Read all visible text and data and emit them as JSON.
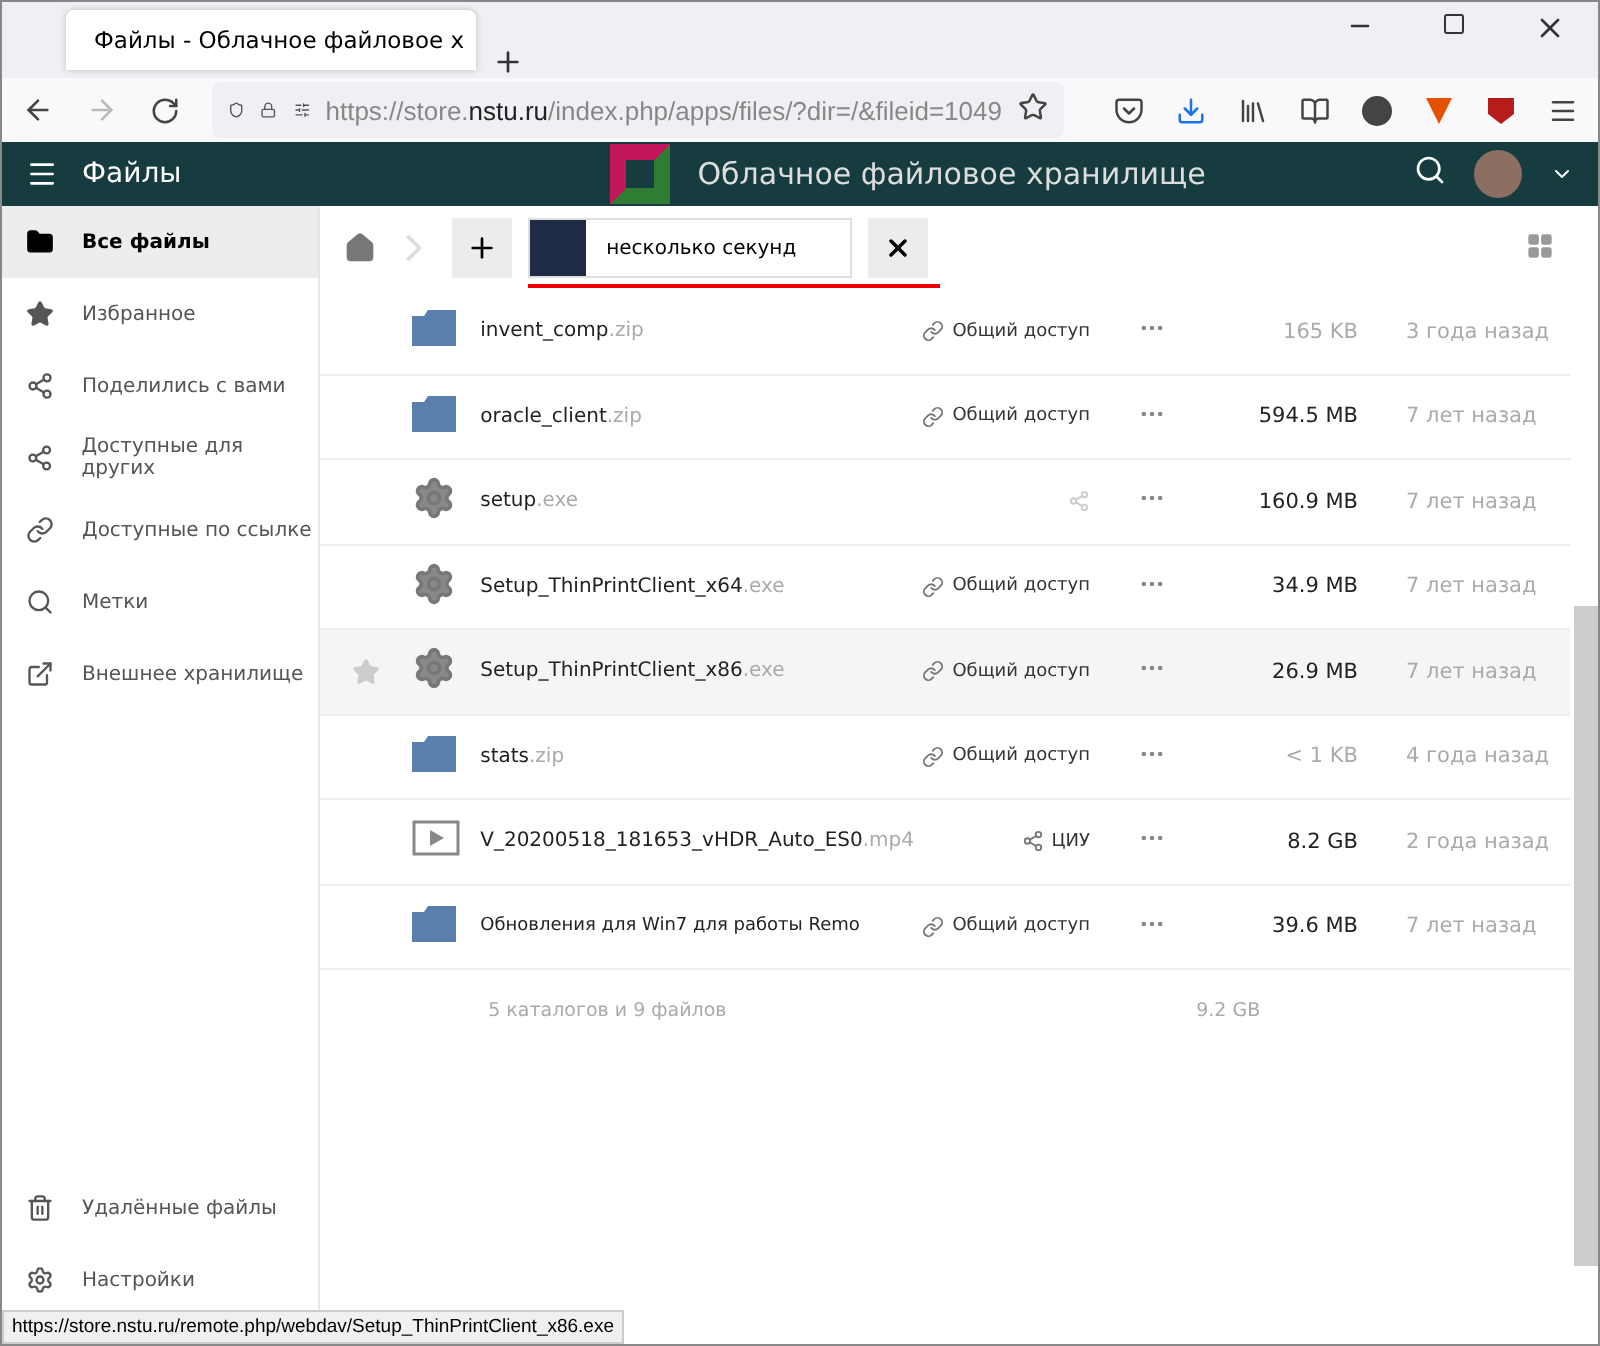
{
  "browser": {
    "tab_title": "Файлы - Облачное файловое х",
    "url_host": "https://store.",
    "url_domain": "nstu.ru",
    "url_path": "/index.php/apps/files/?dir=/&fileid=1049",
    "status_url": "https://store.nstu.ru/remote.php/webdav/Setup_ThinPrintClient_x86.exe"
  },
  "header": {
    "app_name": "Файлы",
    "title": "Облачное файловое хранилище"
  },
  "sidebar": {
    "items": [
      {
        "label": "Все файлы",
        "selected": true
      },
      {
        "label": "Избранное",
        "selected": false
      },
      {
        "label": "Поделились с вами",
        "selected": false
      },
      {
        "label": "Доступные для других",
        "selected": false
      },
      {
        "label": "Доступные по ссылке",
        "selected": false
      },
      {
        "label": "Метки",
        "selected": false
      },
      {
        "label": "Внешнее хранилище",
        "selected": false
      }
    ],
    "bottom": [
      {
        "label": "Удалённые файлы"
      },
      {
        "label": "Настройки"
      }
    ]
  },
  "upload": {
    "status": "несколько секунд",
    "level": 1
  },
  "files": [
    {
      "name": "invent_comp",
      "ext": ".zip",
      "kind": "archive",
      "share": {
        "kind": "link",
        "label": "Общий доступ"
      },
      "size": "165 KB",
      "size_light": true,
      "age": "3 года назад",
      "hovered": false
    },
    {
      "name": "oracle_client",
      "ext": ".zip",
      "kind": "archive",
      "share": {
        "kind": "link",
        "label": "Общий доступ"
      },
      "size": "594.5 MB",
      "size_light": false,
      "age": "7 лет назад",
      "hovered": false
    },
    {
      "name": "setup",
      "ext": ".exe",
      "kind": "program",
      "share": {
        "kind": "icon"
      },
      "size": "160.9 MB",
      "size_light": false,
      "age": "7 лет назад",
      "hovered": false
    },
    {
      "name": "Setup_ThinPrintClient_x64",
      "ext": ".exe",
      "kind": "program",
      "share": {
        "kind": "link",
        "label": "Общий доступ"
      },
      "size": "34.9 MB",
      "size_light": false,
      "age": "7 лет назад",
      "hovered": false
    },
    {
      "name": "Setup_ThinPrintClient_x86",
      "ext": ".exe",
      "kind": "program",
      "share": {
        "kind": "link",
        "label": "Общий доступ"
      },
      "size": "26.9 MB",
      "size_light": false,
      "age": "7 лет назад",
      "hovered": true
    },
    {
      "name": "stats",
      "ext": ".zip",
      "kind": "archive",
      "share": {
        "kind": "link",
        "label": "Общий доступ"
      },
      "size": "< 1 KB",
      "size_light": true,
      "age": "4 года назад",
      "hovered": false
    },
    {
      "name": "V_20200518_181653_vHDR_Auto_ES0",
      "ext": ".mp4",
      "kind": "video",
      "share": {
        "kind": "shared",
        "label": "ЦИУ"
      },
      "size": "8.2 GB",
      "size_light": false,
      "age": "2 года назад",
      "hovered": false
    },
    {
      "name": "Обновления для Win7 для работы Remo",
      "kind": "archive",
      "share": {
        "kind": "link",
        "label": "Общий доступ"
      },
      "size": "39.6 MB",
      "size_light": false,
      "age": "7 лет назад",
      "hovered": false
    }
  ],
  "summary": {
    "text": "5 каталогов и 9 файлов",
    "size": "9.2 GB"
  }
}
